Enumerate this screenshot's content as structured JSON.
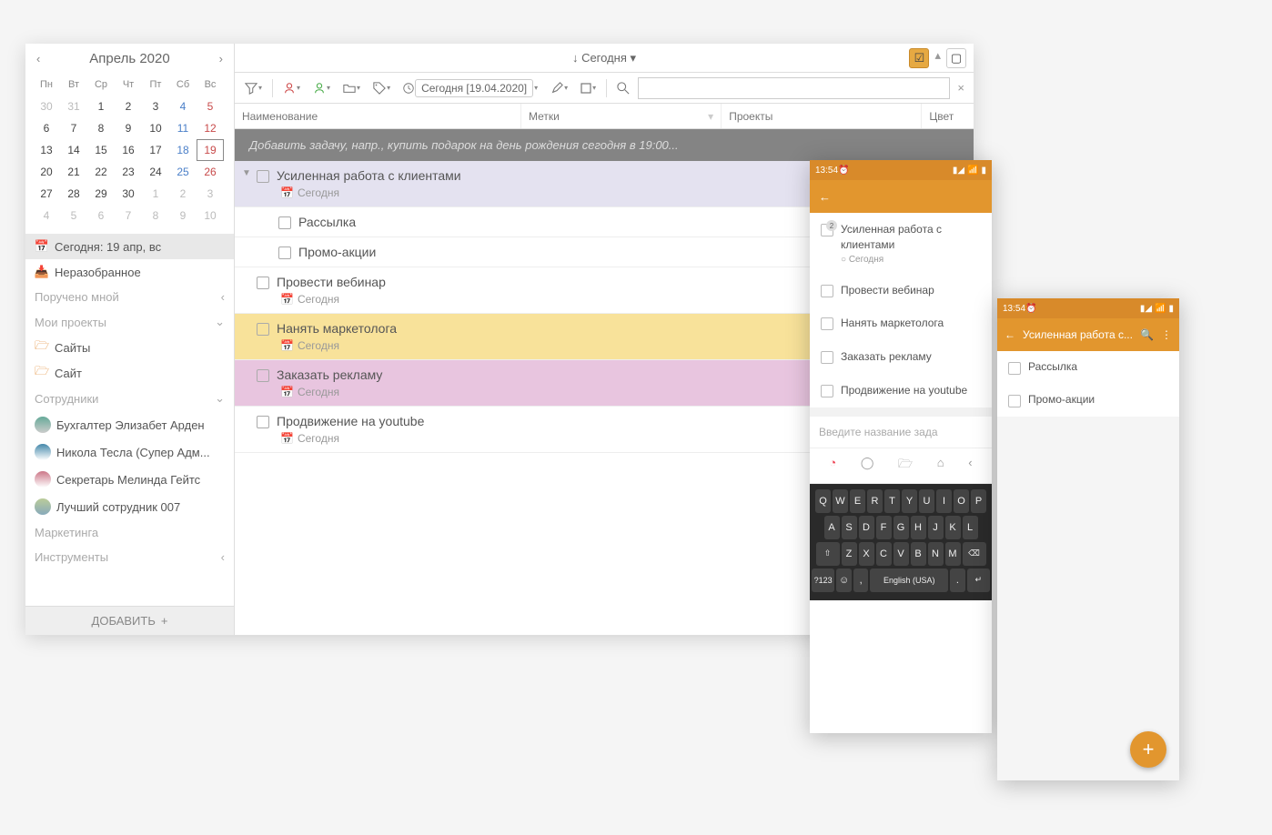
{
  "calendar": {
    "title": "Апрель 2020",
    "days": [
      "Пн",
      "Вт",
      "Ср",
      "Чт",
      "Пт",
      "Сб",
      "Вс"
    ],
    "weeks": [
      [
        {
          "d": "30",
          "m": true
        },
        {
          "d": "31",
          "m": true
        },
        {
          "d": "1"
        },
        {
          "d": "2"
        },
        {
          "d": "3"
        },
        {
          "d": "4",
          "sat": true
        },
        {
          "d": "5",
          "sun": true
        }
      ],
      [
        {
          "d": "6"
        },
        {
          "d": "7"
        },
        {
          "d": "8"
        },
        {
          "d": "9"
        },
        {
          "d": "10"
        },
        {
          "d": "11",
          "sat": true
        },
        {
          "d": "12",
          "sun": true
        }
      ],
      [
        {
          "d": "13"
        },
        {
          "d": "14"
        },
        {
          "d": "15"
        },
        {
          "d": "16"
        },
        {
          "d": "17"
        },
        {
          "d": "18",
          "sat": true
        },
        {
          "d": "19",
          "sun": true,
          "today": true
        }
      ],
      [
        {
          "d": "20"
        },
        {
          "d": "21"
        },
        {
          "d": "22"
        },
        {
          "d": "23"
        },
        {
          "d": "24"
        },
        {
          "d": "25",
          "sat": true
        },
        {
          "d": "26",
          "sun": true
        }
      ],
      [
        {
          "d": "27"
        },
        {
          "d": "28"
        },
        {
          "d": "29"
        },
        {
          "d": "30"
        },
        {
          "d": "1",
          "m": true
        },
        {
          "d": "2",
          "m": true
        },
        {
          "d": "3",
          "m": true
        }
      ],
      [
        {
          "d": "4",
          "m": true
        },
        {
          "d": "5",
          "m": true
        },
        {
          "d": "6",
          "m": true
        },
        {
          "d": "7",
          "m": true
        },
        {
          "d": "8",
          "m": true
        },
        {
          "d": "9",
          "m": true
        },
        {
          "d": "10",
          "m": true
        }
      ]
    ]
  },
  "sidebar": {
    "today": "Сегодня: 19 апр, вс",
    "inbox": "Неразобранное",
    "assigned": "Поручено мной",
    "myprojects": "Мои проекты",
    "sites": "Сайты",
    "site": "Сайт",
    "employees": "Сотрудники",
    "emp1": "Бухгалтер Элизабет Арден",
    "emp2": "Никола Тесла (Супер Адм...",
    "emp3": "Секретарь Мелинда Гейтс",
    "emp4": "Лучший сотрудник 007",
    "marketing": "Маркетинга",
    "tools": "Инструменты",
    "add": "ДОБАВИТЬ"
  },
  "main": {
    "title": "↓ Сегодня ▾",
    "date_filter": "Сегодня [19.04.2020]",
    "col1": "Наименование",
    "col2": "Метки",
    "col3": "Проекты",
    "col4": "Цвет",
    "add_placeholder": "Добавить задачу, напр., купить подарок на день рождения сегодня в 19:00...",
    "today_label": "Сегодня"
  },
  "tasks": {
    "t1": "Усиленная работа с клиентами",
    "t1a": "Рассылка",
    "t1b": "Промо-акции",
    "t2": "Провести вебинар",
    "t3": "Нанять маркетолога",
    "t4": "Заказать рекламу",
    "t5": "Продвижение на youtube"
  },
  "mobile1": {
    "time": "13:54",
    "t1": "Усиленная работа с клиентами",
    "t1_date": "Сегодня",
    "t2": "Провести вебинар",
    "t3": "Нанять маркетолога",
    "t4": "Заказать рекламу",
    "t5": "Продвижение на youtube",
    "input": "Введите название зада",
    "kb_lang": "English (USA)",
    "kb_123": "?123",
    "badge": "2"
  },
  "mobile2": {
    "time": "13:54",
    "title": "Усиленная работа с...",
    "t1": "Рассылка",
    "t2": "Промо-акции"
  },
  "keyboard": {
    "r1": [
      "Q",
      "W",
      "E",
      "R",
      "T",
      "Y",
      "U",
      "I",
      "O",
      "P"
    ],
    "r2": [
      "A",
      "S",
      "D",
      "F",
      "G",
      "H",
      "J",
      "K",
      "L"
    ],
    "r3": [
      "Z",
      "X",
      "C",
      "V",
      "B",
      "N",
      "M"
    ]
  }
}
